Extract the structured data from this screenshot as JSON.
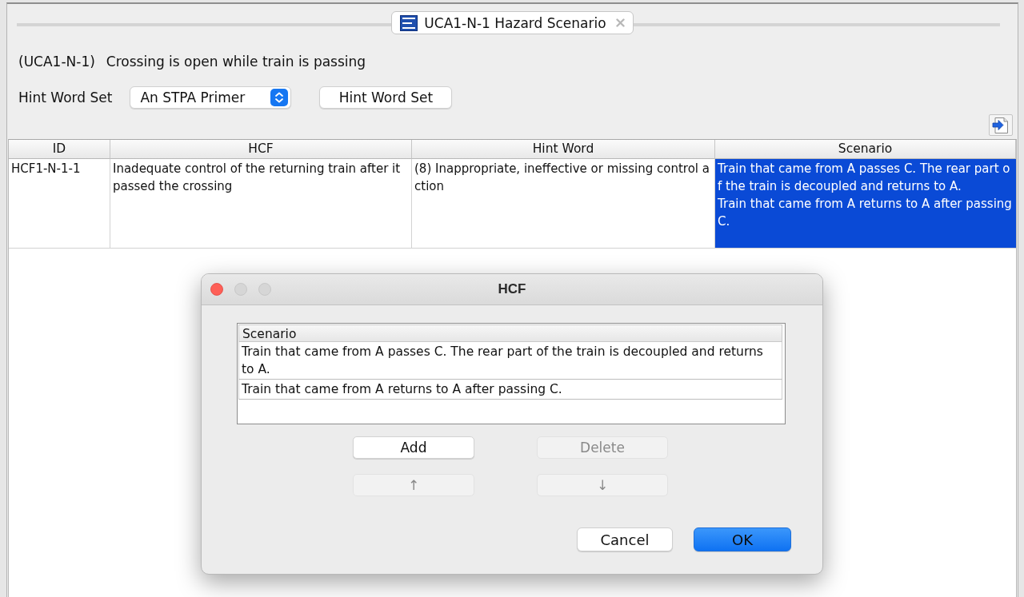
{
  "tab": {
    "title": "UCA1-N-1 Hazard Scenario"
  },
  "uca": {
    "id": "(UCA1-N-1)",
    "description": "Crossing is open while train is passing"
  },
  "hint_word_set": {
    "label": "Hint Word Set",
    "select": {
      "value": "An STPA Primer"
    },
    "button": "Hint Word Set"
  },
  "table": {
    "columns": [
      "ID",
      "HCF",
      "Hint Word",
      "Scenario"
    ],
    "rows": [
      {
        "cells": [
          {
            "kind": "text",
            "text": "HCF1-N-1-1",
            "selected": false
          },
          {
            "kind": "text",
            "text": "Inadequate control of the returning train after it passed the crossing",
            "selected": false
          },
          {
            "kind": "text",
            "text": "(8) Inappropriate, ineffective or missing control action",
            "selected": false
          },
          {
            "kind": "lines",
            "lines": [
              "Train that came from A passes C. The rear part of the train is decoupled and returns to A.",
              "Train that came from A returns to A after passing C."
            ],
            "selected": true
          }
        ]
      }
    ]
  },
  "dialog": {
    "title": "HCF",
    "list": {
      "header": "Scenario",
      "rows": [
        "Train that came from A passes C. The rear part of the train is decoupled and returns to A.",
        "Train that came from A returns to A after passing C."
      ]
    },
    "buttons": [
      {
        "label": "Add",
        "disabled": false
      },
      {
        "label": "Delete",
        "disabled": true
      },
      {
        "label": "↑",
        "disabled": true
      },
      {
        "label": "↓",
        "disabled": true
      }
    ],
    "footer_buttons": [
      {
        "label": "Cancel",
        "primary": false
      },
      {
        "label": "OK",
        "primary": true
      }
    ]
  }
}
